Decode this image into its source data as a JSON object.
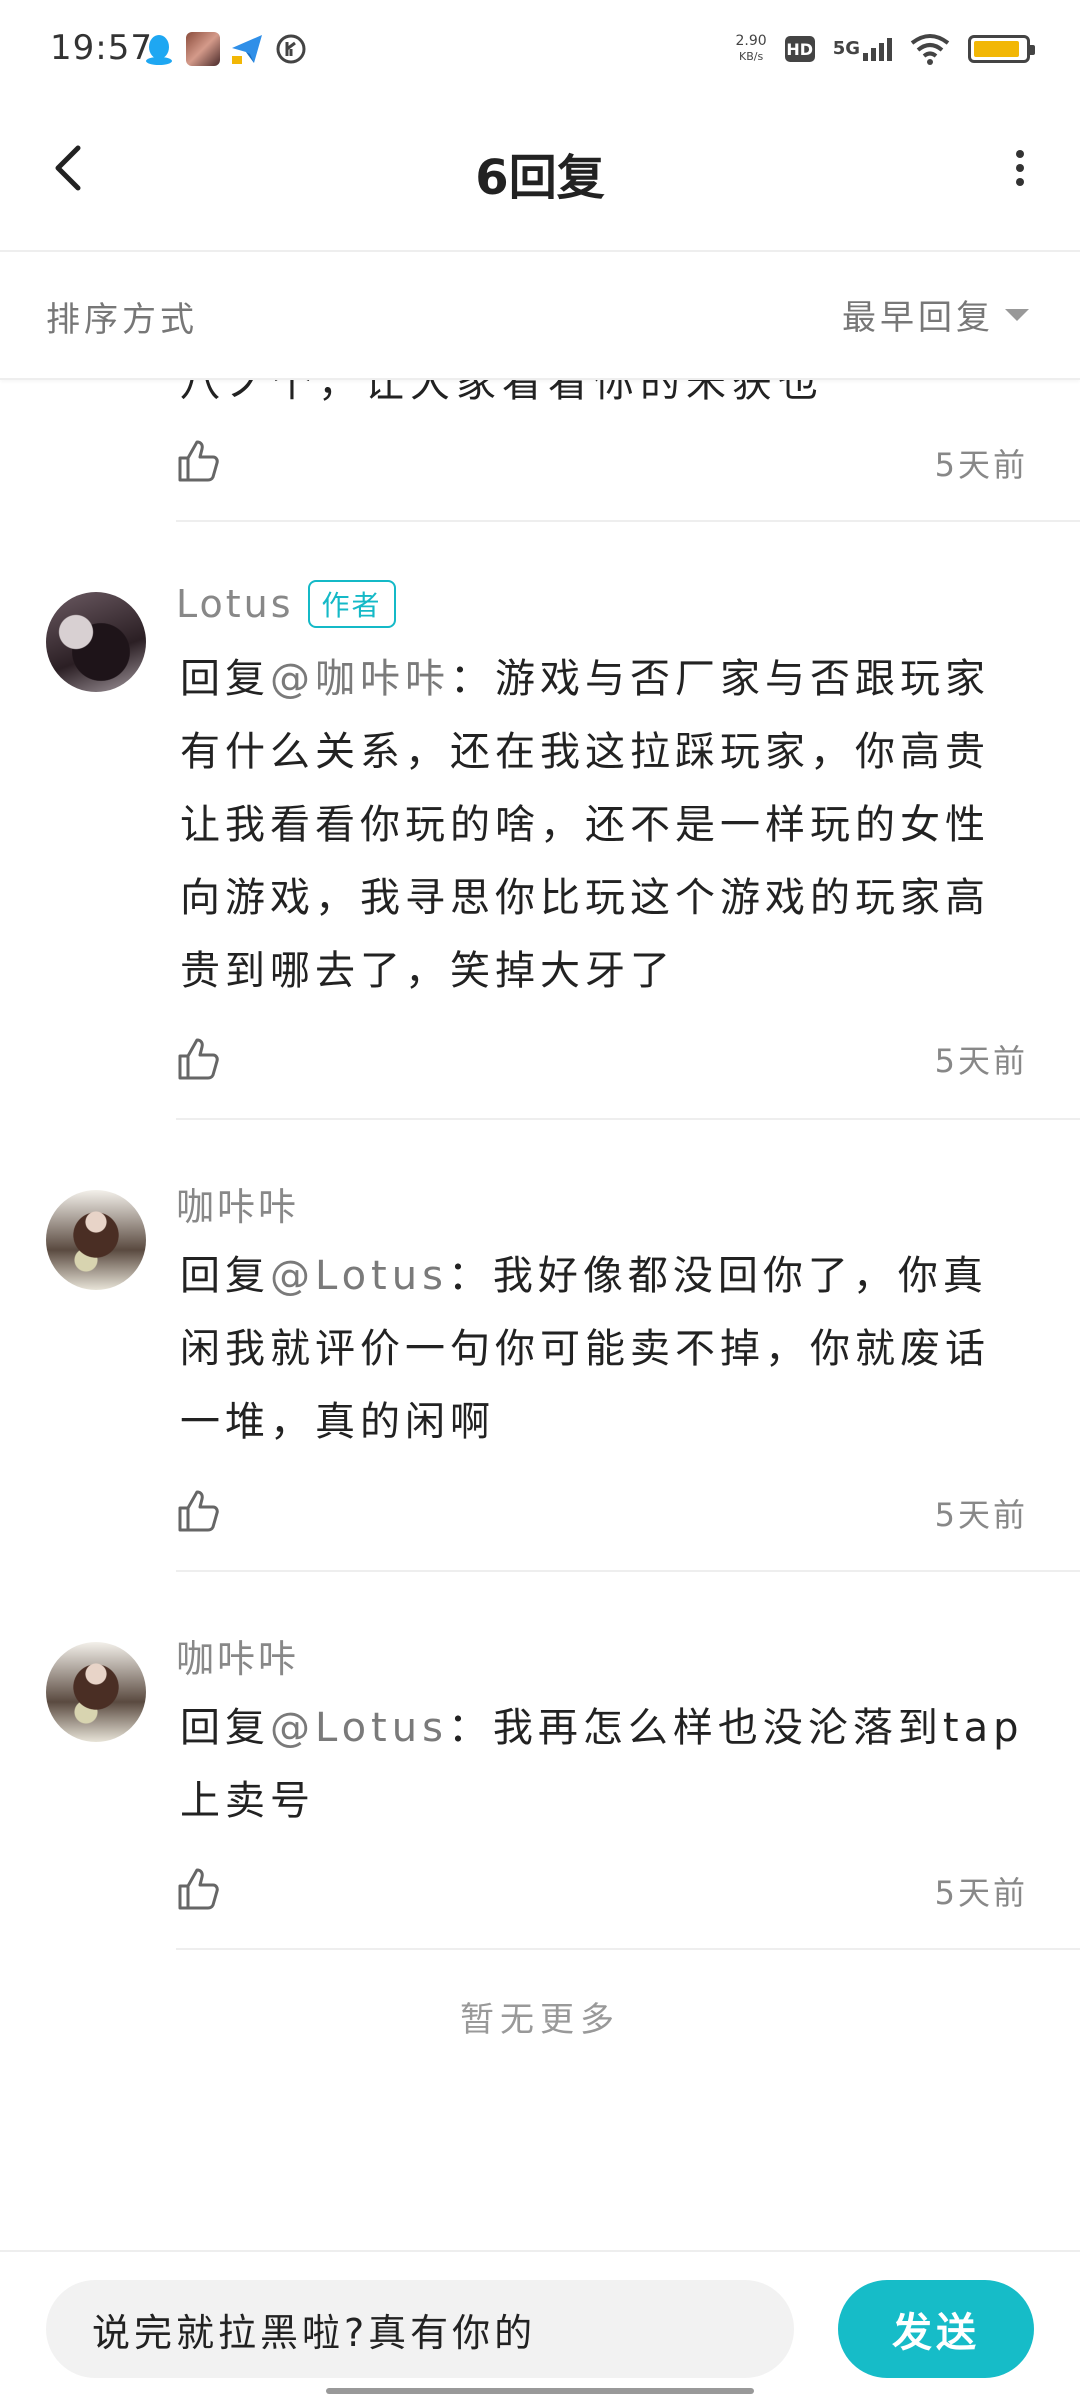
{
  "status_bar": {
    "time": "19:57",
    "speed_value": "2.90",
    "speed_unit": "KB/s",
    "hd_label": "HD",
    "network_label": "5G",
    "battery_color": "#f2b705"
  },
  "header": {
    "title": "6回复",
    "back_icon": "chevron-left-icon",
    "more_icon": "more-vertical-icon"
  },
  "sort": {
    "label": "排序方式",
    "value": "最早回复"
  },
  "partial_comment": {
    "text": "八ノ个，让大家看看你的米获也",
    "time": "5天前"
  },
  "comments": [
    {
      "name": "Lotus",
      "badge": "作者",
      "reply_prefix": "回复",
      "mention": "@咖咔咔",
      "text": "：游戏与否厂家与否跟玩家有什么关系，还在我这拉踩玩家，你高贵让我看看你玩的啥，还不是一样玩的女性向游戏，我寻思你比玩这个游戏的玩家高贵到哪去了，笑掉大牙了",
      "time": "5天前"
    },
    {
      "name": "咖咔咔",
      "reply_prefix": "回复",
      "mention": "@Lotus",
      "text": "：我好像都没回你了，你真闲我就评价一句你可能卖不掉，你就废话一堆，真的闲啊",
      "time": "5天前"
    },
    {
      "name": "咖咔咔",
      "reply_prefix": "回复",
      "mention": "@Lotus",
      "text": "：我再怎么样也没沦落到tap上卖号",
      "time": "5天前"
    }
  ],
  "no_more": "暂无更多",
  "input": {
    "value": "说完就拉黑啦?真有你的"
  },
  "send_label": "发送",
  "accent_color": "#16bcc8"
}
